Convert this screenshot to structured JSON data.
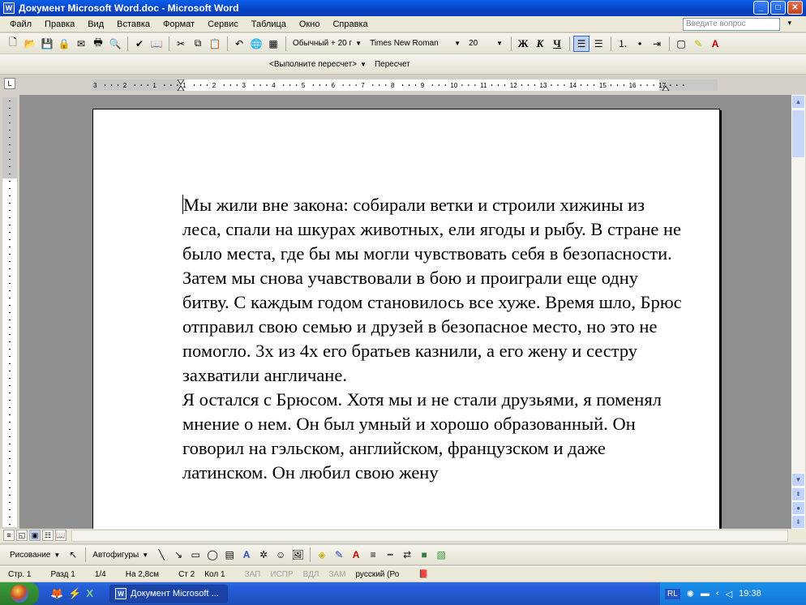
{
  "window": {
    "title": "Документ Microsoft Word.doc - Microsoft Word",
    "app_icon": "W",
    "min": "_",
    "max": "□",
    "close": "✕"
  },
  "menu": [
    "Файл",
    "Правка",
    "Вид",
    "Вставка",
    "Формат",
    "Сервис",
    "Таблица",
    "Окно",
    "Справка"
  ],
  "help_box": {
    "placeholder": "Введите вопрос"
  },
  "toolbar": {
    "style": "Обычный + 20 г",
    "font": "Times New Roman",
    "size": "20",
    "bold": "Ж",
    "italic": "К",
    "underline": "Ч"
  },
  "toolbar2": {
    "recalc_field": "<Выполните пересчет>",
    "recalc_button": "Пересчет"
  },
  "ruler": {
    "marks": [
      "3",
      "2",
      "1",
      "1",
      "2",
      "3",
      "4",
      "5",
      "6",
      "7",
      "8",
      "9",
      "10",
      "11",
      "12",
      "13",
      "14",
      "15",
      "16",
      "17"
    ]
  },
  "document": {
    "paragraphs": [
      "Мы жили вне закона: собирали ветки и строили хижины из леса, спали на шкурах животных, ели ягоды и рыбу. В стране не было места, где бы мы могли чувствовать себя в безопасности. Затем мы снова учавствовали в бою и проиграли еще одну битву. С каждым годом становилось все хуже. Время шло, Брюс отправил свою семью и друзей в безопасное место, но это не помогло. 3х из 4х его братьев казнили, а его жену и сестру захватили англичане.",
      "Я остался с Брюсом. Хотя мы и не стали друзьями, я поменял мнение о нем. Он был умный и хорошо образованный. Он говорил на гэльском, английском, французском и даже латинском. Он любил свою жену"
    ]
  },
  "drawbar": {
    "draw": "Рисование",
    "autoshapes": "Автофигуры"
  },
  "status": {
    "page": "Стр. 1",
    "section": "Разд 1",
    "pages": "1/4",
    "at": "На 2,8см",
    "line": "Ст 2",
    "col": "Кол 1",
    "rec": "ЗАП",
    "trk": "ИСПР",
    "ext": "ВДЛ",
    "ovr": "ЗАМ",
    "lang": "русский (Ро"
  },
  "taskbar": {
    "task_label": "Документ Microsoft ...",
    "lang": "RL",
    "time": "19:38"
  }
}
